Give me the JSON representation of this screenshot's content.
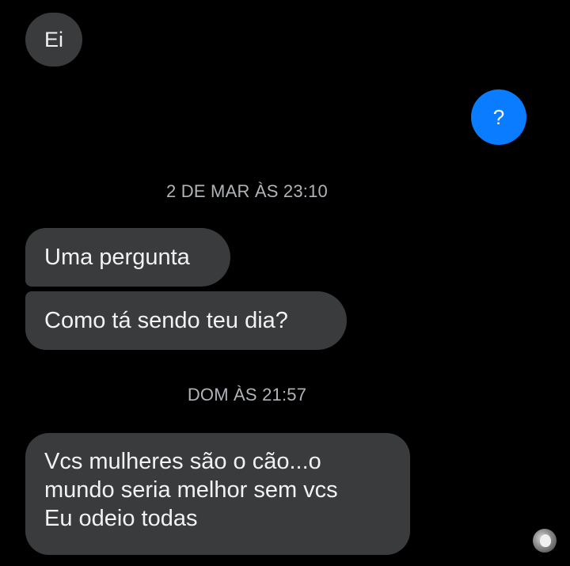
{
  "conversation": {
    "messages": [
      {
        "text": "Ei"
      },
      {
        "text": "?"
      },
      {
        "text": "Uma pergunta"
      },
      {
        "text": "Como tá sendo teu dia?"
      },
      {
        "lines": [
          "Vcs mulheres são o cão...o",
          "mundo seria melhor sem vcs",
          "Eu odeio todas"
        ]
      }
    ],
    "timestamps": [
      "2 DE MAR ÀS 23:10",
      "DOM ÀS 21:57"
    ]
  },
  "colors": {
    "background": "#000000",
    "received_bubble": "#3a3b3c",
    "sent_bubble": "#0a7cff",
    "timestamp_text": "#b0b3b8"
  },
  "icons": {
    "seen_indicator": "seen-avatar-icon"
  }
}
